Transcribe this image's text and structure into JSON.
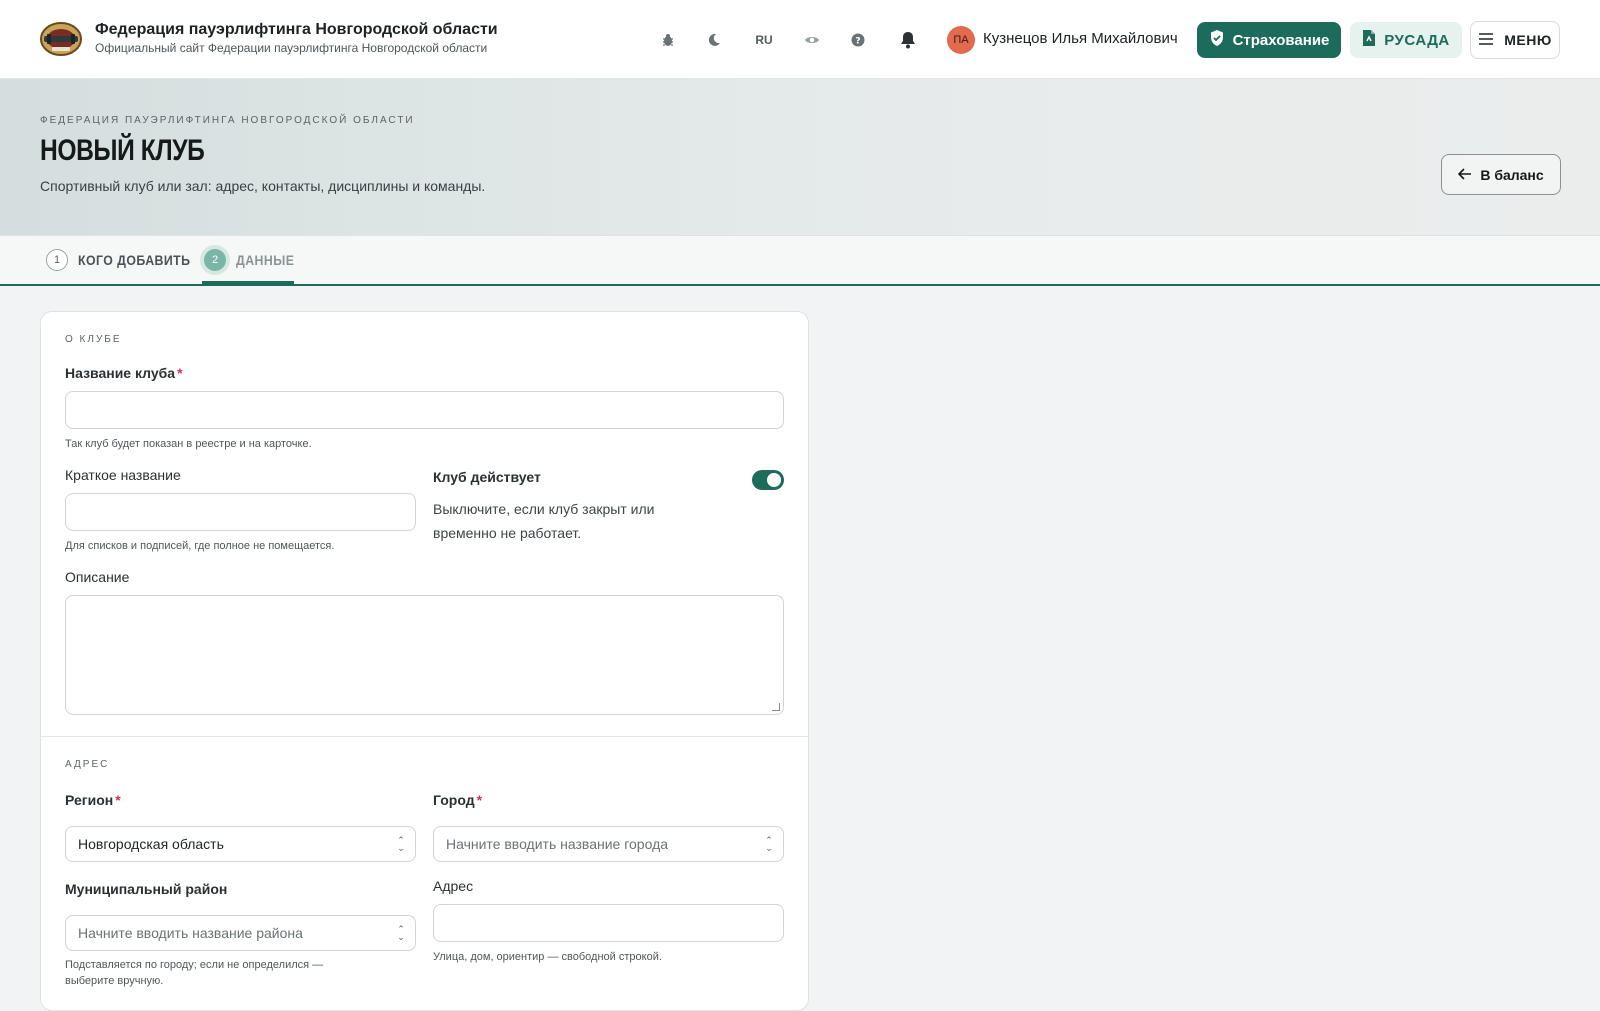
{
  "topbar": {
    "title": "Федерация пауэрлифтинга Новгородской области",
    "subtitle": "Официальный сайт Федерации пауэрлифтинга Новгородской области",
    "lang": "RU",
    "avatar_initials": "ПА",
    "user_name": "Кузнецов Илья Михайлович",
    "insurance_label": "Страхование",
    "rusada_label": "РУСАДА",
    "menu_label": "МЕНЮ"
  },
  "hero": {
    "breadcrumb": "Федерация пауэрлифтинга Новгородской области",
    "title": "НОВЫЙ КЛУБ",
    "subtitle": "Спортивный клуб или зал: адрес, контакты, дисциплины и команды.",
    "back_label": "В баланс"
  },
  "steps": [
    {
      "num": "1",
      "label": "КОГО ДОБАВИТЬ"
    },
    {
      "num": "2",
      "label": "ДАННЫЕ"
    }
  ],
  "form": {
    "about_title": "О клубе",
    "name_label": "Название клуба",
    "required_mark": "*",
    "name_value": "",
    "name_hint": "Так клуб будет показан в реестре и на карточке.",
    "short_label": "Краткое название",
    "short_value": "",
    "short_hint": "Для списков и подписей, где полное не помещается.",
    "active_label": "Клуб действует",
    "active_on": true,
    "active_desc": "Выключите, если клуб закрыт или временно не работает.",
    "desc_label": "Описание",
    "desc_value": "",
    "address_title": "Адрес",
    "region_label": "Регион",
    "region_value": "Новгородская область",
    "city_label": "Город",
    "city_placeholder": "Начните вводить название города",
    "district_label": "Муниципальный район",
    "district_placeholder": "Начните вводить название района",
    "district_hint": "Подставляется по городу; если не определился — выберите вручную.",
    "address_label": "Адрес",
    "address_value": "",
    "address_hint": "Улица, дом, ориентир — свободной строкой."
  },
  "colors": {
    "accent": "#1d6b5a",
    "accent_light": "#e6f2ee",
    "required": "#d0344b",
    "avatar": "#e36a4f"
  },
  "icons": {
    "bug": "bug-icon",
    "theme": "moon-icon",
    "eye": "eye-icon",
    "help": "help-icon",
    "bell": "bell-icon",
    "shield": "shield-check-icon",
    "doc": "document-icon",
    "menu": "menu-icon",
    "back": "arrow-left-icon"
  }
}
